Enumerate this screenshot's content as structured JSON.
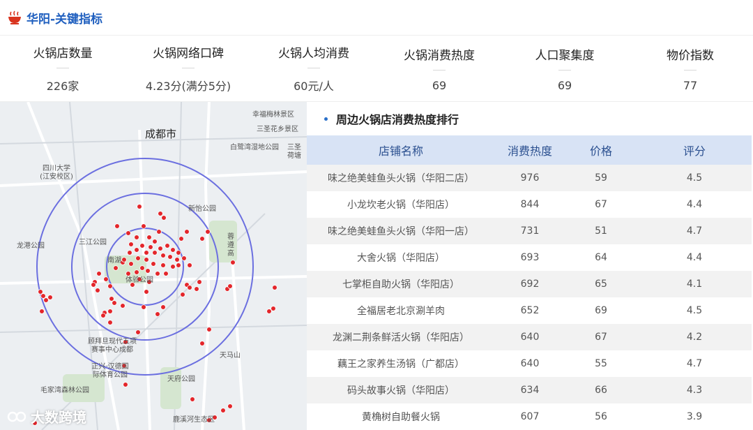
{
  "header": {
    "title": "华阳-关键指标"
  },
  "kpis": [
    {
      "label": "火锅店数量",
      "value": "226家"
    },
    {
      "label": "火锅网络口碑",
      "value": "4.23分(满分5分)"
    },
    {
      "label": "火锅人均消费",
      "value": "60元/人"
    },
    {
      "label": "火锅消费热度",
      "value": "69"
    },
    {
      "label": "人口聚集度",
      "value": "69"
    },
    {
      "label": "物价指数",
      "value": "77"
    }
  ],
  "map": {
    "labels": {
      "city": "成都市",
      "xingfu_meilin": "幸福梅林景区",
      "sansheng_huaxiang": "三圣花乡景区",
      "bailu_wetland": "白鹭湾湿地公园",
      "sansheng_he": "三圣荷塘",
      "sichuan_univ": "四川大学(江安校区)",
      "xinyi_park": "新怡公园",
      "longgang_park": "龙港公园",
      "sanjiang_park": "三江公园",
      "nanhu": "南湖",
      "tiyu_park": "体验公园",
      "airport_highway": "蓉遵高",
      "swcc": "顾拜旦现代五项赛事中心成都",
      "zhengxing": "正兴·汉德国际体育公园",
      "tianma_shan": "天马山",
      "tianfu_park": "天府公园",
      "maojia_wan": "毛家湾森林公园",
      "luxi_river": "鹿溪河生态区"
    },
    "dot_color": "#e3262b",
    "ring_color": "#6b6fe0"
  },
  "brand": {
    "name": "大数跨境"
  },
  "ranking": {
    "title": "周边火锅店消费热度排行",
    "columns": [
      "店铺名称",
      "消费热度",
      "价格",
      "评分"
    ],
    "rows": [
      {
        "name": "味之绝美蛙鱼头火锅（华阳二店）",
        "heat": "976",
        "price": "59",
        "score": "4.5"
      },
      {
        "name": "小龙坎老火锅（华阳店）",
        "heat": "844",
        "price": "67",
        "score": "4.4"
      },
      {
        "name": "味之绝美蛙鱼头火锅（华阳一店）",
        "heat": "731",
        "price": "51",
        "score": "4.7"
      },
      {
        "name": "大舍火锅（华阳店）",
        "heat": "693",
        "price": "64",
        "score": "4.4"
      },
      {
        "name": "七掌柜自助火锅（华阳店）",
        "heat": "692",
        "price": "65",
        "score": "4.1"
      },
      {
        "name": "全福居老北京涮羊肉",
        "heat": "652",
        "price": "69",
        "score": "4.5"
      },
      {
        "name": "龙渊二荆条鲜活火锅（华阳店）",
        "heat": "640",
        "price": "67",
        "score": "4.2"
      },
      {
        "name": "藕王之家养生汤锅（广都店）",
        "heat": "640",
        "price": "55",
        "score": "4.7"
      },
      {
        "name": "码头故事火锅（华阳店）",
        "heat": "634",
        "price": "66",
        "score": "4.3"
      },
      {
        "name": "黄桷树自助餐火锅",
        "heat": "607",
        "price": "56",
        "score": "3.9"
      }
    ]
  },
  "colors": {
    "accent": "#1f5fbf",
    "table_header_bg": "#d8e3f5",
    "table_header_text": "#2a4f8f"
  }
}
